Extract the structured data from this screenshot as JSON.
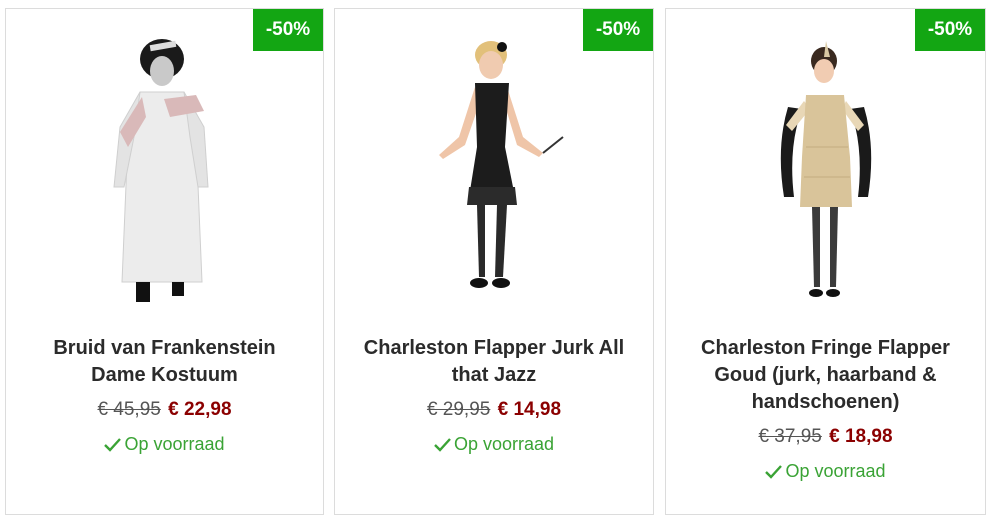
{
  "colors": {
    "badge": "#13a613",
    "price_new": "#8b0000",
    "in_stock": "#3aa335"
  },
  "products": [
    {
      "badge": "-50%",
      "title": "Bruid van Frankenstein Dame Kostuum",
      "old_price": "€ 45,95",
      "new_price": "€ 22,98",
      "stock": "Op voorraad",
      "image_icon": "bride-costume-image"
    },
    {
      "badge": "-50%",
      "title": "Charleston Flapper Jurk All that Jazz",
      "old_price": "€ 29,95",
      "new_price": "€ 14,98",
      "stock": "Op voorraad",
      "image_icon": "black-flapper-dress-image"
    },
    {
      "badge": "-50%",
      "title": "Charleston Fringe Flapper Goud (jurk, haarband & handschoenen)",
      "old_price": "€ 37,95",
      "new_price": "€ 18,98",
      "stock": "Op voorraad",
      "image_icon": "gold-flapper-dress-image"
    }
  ]
}
